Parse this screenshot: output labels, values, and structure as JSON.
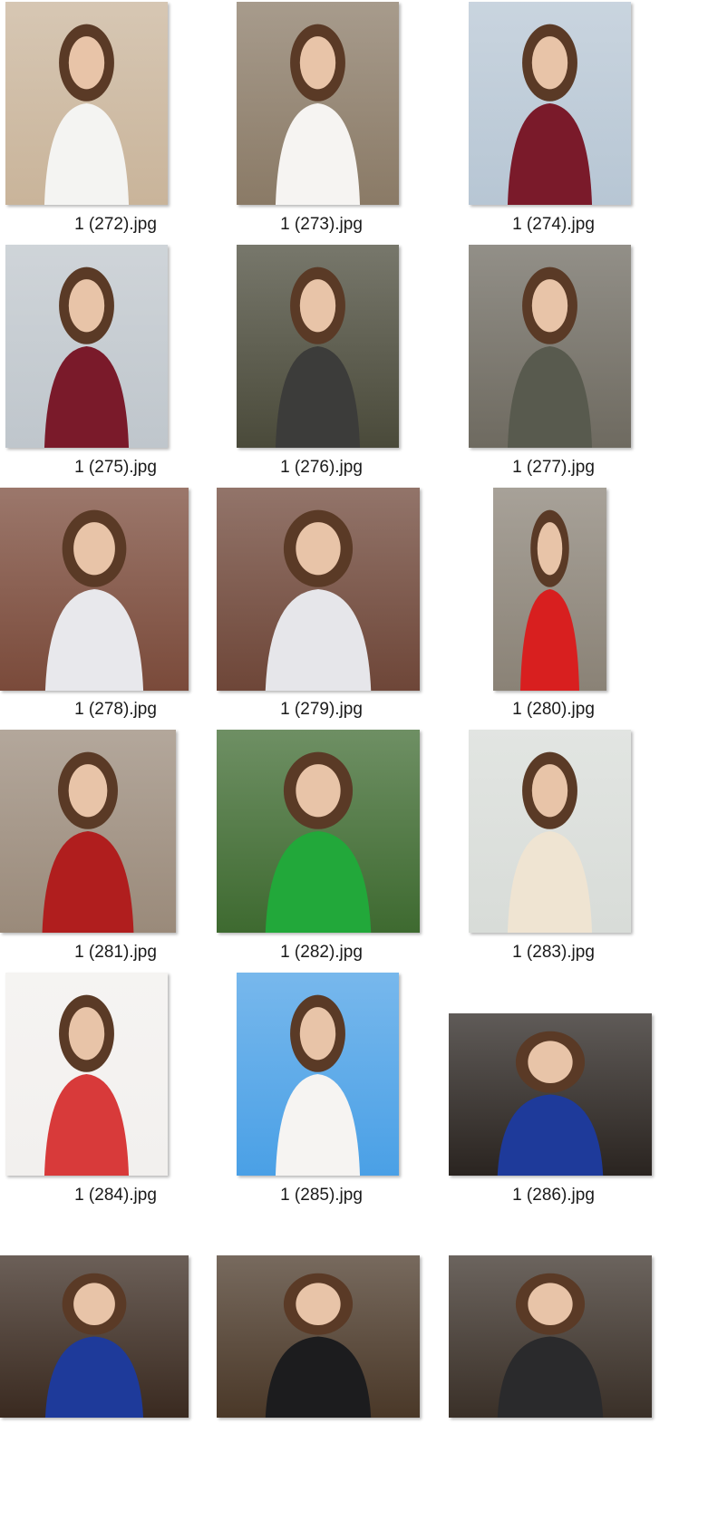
{
  "gallery": {
    "items": [
      {
        "label": "1 (272).jpg",
        "bg": "#c9b49a",
        "accent": "#f4f4f2"
      },
      {
        "label": "1 (273).jpg",
        "bg": "#8a7a66",
        "accent": "#f6f4f2"
      },
      {
        "label": "1 (274).jpg",
        "bg": "#b7c6d4",
        "accent": "#7a1a2a"
      },
      {
        "label": "1 (275).jpg",
        "bg": "#bfc6cc",
        "accent": "#7a1a2a"
      },
      {
        "label": "1 (276).jpg",
        "bg": "#4a4a3a",
        "accent": "#3c3c3a"
      },
      {
        "label": "1 (277).jpg",
        "bg": "#6e6a60",
        "accent": "#585a4e"
      },
      {
        "label": "1 (278).jpg",
        "bg": "#7a4a3a",
        "accent": "#e8e8ec"
      },
      {
        "label": "1 (279).jpg",
        "bg": "#6e4638",
        "accent": "#e6e6ea"
      },
      {
        "label": "1 (280).jpg",
        "bg": "#8a8276",
        "accent": "#d81f1f"
      },
      {
        "label": "1 (281).jpg",
        "bg": "#9a8a7a",
        "accent": "#b01e1e"
      },
      {
        "label": "1 (282).jpg",
        "bg": "#3e6a30",
        "accent": "#22a83a"
      },
      {
        "label": "1 (283).jpg",
        "bg": "#d8dcd8",
        "accent": "#efe4d2"
      },
      {
        "label": "1 (284).jpg",
        "bg": "#f2f0ee",
        "accent": "#d83a3a"
      },
      {
        "label": "1 (285).jpg",
        "bg": "#4aa0e6",
        "accent": "#f6f4f2"
      },
      {
        "label": "1 (286).jpg",
        "bg": "#2a2420",
        "accent": "#1e3a9a"
      },
      {
        "label": "",
        "bg": "#3a2a20",
        "accent": "#1e3a9a"
      },
      {
        "label": "",
        "bg": "#4a3828",
        "accent": "#1c1c1e"
      },
      {
        "label": "",
        "bg": "#3a3028",
        "accent": "#2a2a2c"
      }
    ]
  }
}
